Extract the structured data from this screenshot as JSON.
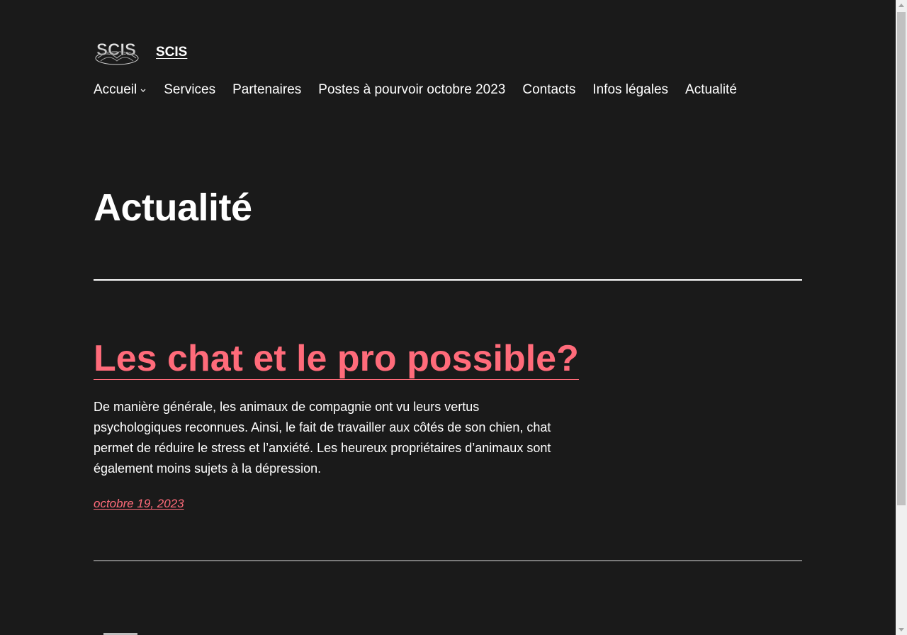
{
  "header": {
    "logo_text": "SCIS",
    "site_title": "SCIS"
  },
  "nav": {
    "items": [
      {
        "label": "Accueil",
        "has_submenu": true
      },
      {
        "label": "Services"
      },
      {
        "label": "Partenaires"
      },
      {
        "label": "Postes à pourvoir octobre 2023"
      },
      {
        "label": "Contacts"
      },
      {
        "label": "Infos légales"
      },
      {
        "label": "Actualité"
      }
    ]
  },
  "main": {
    "page_title": "Actualité",
    "posts": [
      {
        "title": "Les chat et le pro possible?",
        "excerpt": "De manière générale, les animaux de compagnie ont vu leurs vertus psychologiques reconnues. Ainsi, le fait de travailler aux côtés de son chien, chat permet de réduire le stress et l’anxiété. Les heureux propriétaires d’animaux sont également moins sujets à la dépression.",
        "date": "octobre 19, 2023"
      }
    ]
  },
  "colors": {
    "background": "#1a1a1a",
    "text": "#ffffff",
    "accent": "#ff6b7a",
    "divider": "#ffffff",
    "divider_muted": "#7a7a7a"
  }
}
